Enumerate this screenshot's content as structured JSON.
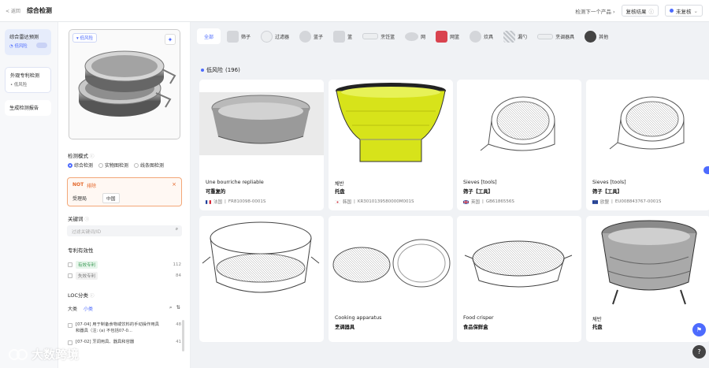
{
  "topbar": {
    "back_label": "< 返回",
    "title": "综合检测",
    "next_product": "检测下一个产品",
    "recheck_result": "复核结果",
    "review_status": "未复核"
  },
  "steps": [
    {
      "label": "综合雷达预测",
      "sub": "低风险"
    },
    {
      "label": "外观专利检测",
      "sub": "低风险"
    },
    {
      "label": "生成检测报告",
      "sub": ""
    }
  ],
  "filter": {
    "query_tag": "低风险",
    "mode_label": "检测模式",
    "modes": [
      "综合检测",
      "实物图检测",
      "线条图检测"
    ],
    "not_label": "NOT",
    "exclude_label": "排除",
    "office_label": "受理局",
    "office_value": "中国",
    "keyword_label": "关键词",
    "keyword_placeholder": "过滤关键词/ID",
    "validity_label": "专利有效性",
    "validity": [
      {
        "label": "有效专利",
        "count": "112"
      },
      {
        "label": "失效专利",
        "count": "84"
      }
    ],
    "loc_label": "LOC分类",
    "loc_tabs": [
      "大类",
      "小类"
    ],
    "loc_items": [
      {
        "text": "[07-04] 用于制备食物或饮料的手动操作用具和器具（注: (a) 不包括07-0...",
        "count": "48"
      },
      {
        "text": "[07-02] 烹调用具、器具和容器",
        "count": "41"
      }
    ]
  },
  "categories": [
    {
      "label": "全部",
      "thumb": "none"
    },
    {
      "label": "筛子",
      "thumb": "grey"
    },
    {
      "label": "过滤器",
      "thumb": "round"
    },
    {
      "label": "蓝子",
      "thumb": "round"
    },
    {
      "label": "篮",
      "thumb": "grey"
    },
    {
      "label": "烹饪篮",
      "thumb": "lite"
    },
    {
      "label": "网",
      "thumb": "round"
    },
    {
      "label": "网篮",
      "thumb": "red"
    },
    {
      "label": "炊具",
      "thumb": "round"
    },
    {
      "label": "漏勺",
      "thumb": "grid"
    },
    {
      "label": "烹调器具",
      "thumb": "lite"
    },
    {
      "label": "其他",
      "thumb": "dark"
    }
  ],
  "results": {
    "risk_label": "低风险",
    "count": "(196)"
  },
  "cards": [
    {
      "en": "Une bourriche repliable",
      "cn": "可重复的",
      "country": "法国",
      "number": "FR810098-0001S",
      "flag": "fr"
    },
    {
      "en": "채반",
      "cn": "托盘",
      "country": "韩国",
      "number": "KR3010139580000M001S",
      "flag": "kr"
    },
    {
      "en": "Sieves [tools]",
      "cn": "筛子【工具】",
      "country": "英国",
      "number": "GB6186556S",
      "flag": "gb"
    },
    {
      "en": "Sieves [tools]",
      "cn": "筛子【工具】",
      "country": "欧盟",
      "number": "EU008843767-0001S",
      "flag": "eu"
    },
    {
      "en": "",
      "cn": "",
      "country": "",
      "number": "",
      "flag": ""
    },
    {
      "en": "Cooking apparatus",
      "cn": "烹调器具",
      "country": "",
      "number": "",
      "flag": ""
    },
    {
      "en": "Food crisper",
      "cn": "食品保鲜盒",
      "country": "",
      "number": "",
      "flag": ""
    },
    {
      "en": "채반",
      "cn": "托盘",
      "country": "",
      "number": "",
      "flag": ""
    }
  ],
  "watermark": "大数跨境",
  "colors": {
    "accent": "#4d6bfe",
    "warn": "#e4672a",
    "valid": "#3a9a55"
  }
}
